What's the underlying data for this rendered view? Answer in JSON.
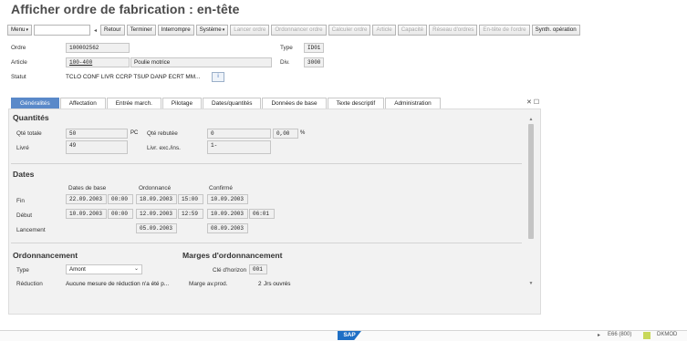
{
  "header": {
    "title": "Afficher ordre de fabrication : en-tête"
  },
  "toolbar": {
    "menu_label": "Menu",
    "back_label": "Retour",
    "finish_label": "Terminer",
    "interrupt_label": "Interrompre",
    "system_label": "Système",
    "launch_label": "Lancer ordre",
    "schedule_label": "Ordonnancer ordre",
    "calc_label": "Calculer ordre",
    "article_label": "Article",
    "capacity_label": "Capacité",
    "network_label": "Réseau d'ordres",
    "header_label": "En-tête de l'ordre",
    "synth_label": "Synth. opération"
  },
  "order": {
    "ordre_label": "Ordre",
    "ordre_value": "100002562",
    "type_label": "Type",
    "type_value": "ID01",
    "article_label": "Article",
    "article_value": "100-400",
    "article_desc": "Poulie motrice",
    "div_label": "Div.",
    "div_value": "3000",
    "statut_label": "Statut",
    "statut_value": "TCLO CONF LIVR CCRP TSUP DANP ECRT MM...",
    "info_icon_glyph": "i"
  },
  "tabs": [
    {
      "label": "Généralités"
    },
    {
      "label": "Affectation"
    },
    {
      "label": "Entrée march."
    },
    {
      "label": "Pilotage"
    },
    {
      "label": "Dates/quantités"
    },
    {
      "label": "Données de base"
    },
    {
      "label": "Texte descriptif"
    },
    {
      "label": "Administration"
    }
  ],
  "quantities": {
    "section_title": "Quantités",
    "total_label": "Qté totale",
    "total_value": "50",
    "unit": "PC",
    "scrap_label": "Qté rebutée",
    "scrap_value": "0",
    "scrap_pct": "0,00",
    "pct_sign": "%",
    "delivered_label": "Livré",
    "delivered_value": "49",
    "excess_label": "Livr. exc./ins.",
    "excess_value": "1-"
  },
  "dates": {
    "section_title": "Dates",
    "col_base": "Dates de base",
    "col_sched": "Ordonnancé",
    "col_conf": "Confirmé",
    "fin_label": "Fin",
    "debut_label": "Début",
    "launch_label": "Lancement",
    "fin": {
      "base_date": "22.09.2003",
      "base_time": "00:00",
      "sched_date": "18.09.2003",
      "sched_time": "15:00",
      "conf_date": "10.09.2003"
    },
    "debut": {
      "base_date": "10.09.2003",
      "base_time": "00:00",
      "sched_date": "12.09.2003",
      "sched_time": "12:59",
      "conf_date": "10.09.2003",
      "conf_time": "06:01"
    },
    "launch": {
      "sched_date": "05.09.2003",
      "conf_date": "08.09.2003"
    }
  },
  "scheduling": {
    "section_title": "Ordonnancement",
    "type_label": "Type",
    "type_value": "Amont",
    "reduction_label": "Réduction",
    "reduction_value": "Aucune mesure de réduction n'a été p..."
  },
  "margins": {
    "section_title": "Marges d'ordonnancement",
    "horizon_label": "Clé d'horizon",
    "horizon_value": "001",
    "margin_label": "Marge av.prod.",
    "margin_value": "2",
    "margin_unit": "Jrs ouvrés"
  },
  "footer": {
    "sap_label": "SAP",
    "system_info": "E66 (800)",
    "server": "DKMOD",
    "expand_glyph": "▸"
  },
  "colors": {
    "active_tab": "#5a89c9",
    "sap_blue": "#1f6fc5"
  }
}
